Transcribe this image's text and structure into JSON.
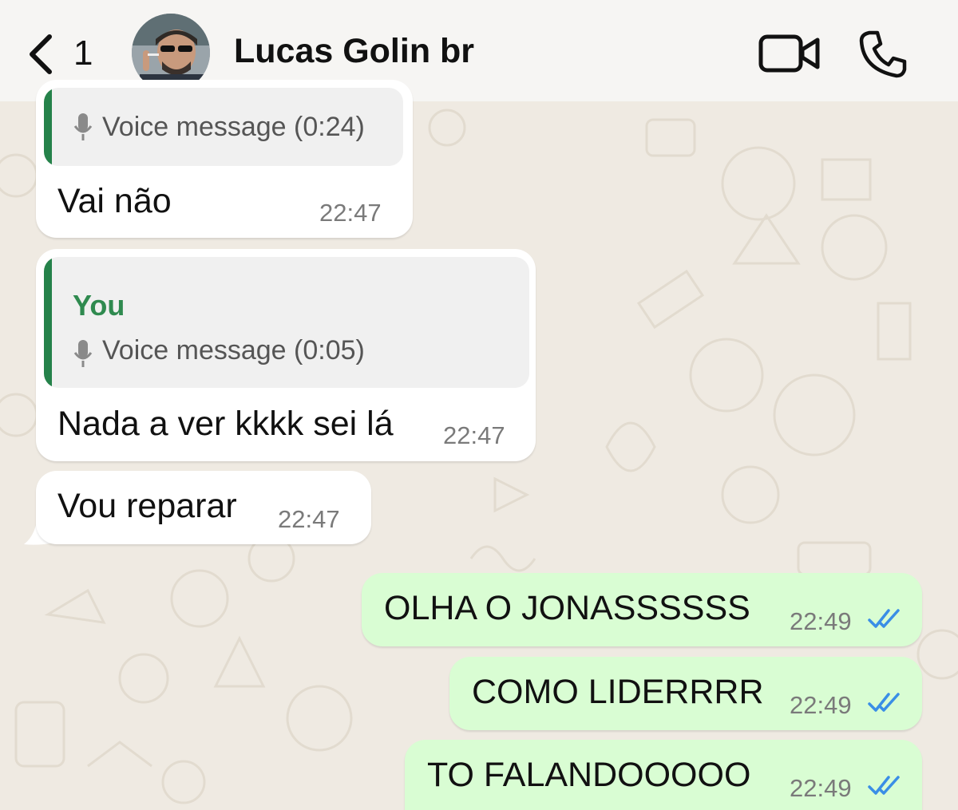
{
  "header": {
    "unread_count": "1",
    "contact_name": "Lucas Golin br"
  },
  "messages": [
    {
      "direction": "in",
      "quote": {
        "text": "Voice message (0:24)"
      },
      "text": "Vai não",
      "time": "22:47"
    },
    {
      "direction": "in",
      "quote": {
        "author": "You",
        "text": "Voice message (0:05)"
      },
      "text": "Nada a ver kkkk sei lá",
      "time": "22:47"
    },
    {
      "direction": "in",
      "text": "Vou reparar",
      "time": "22:47"
    },
    {
      "direction": "out",
      "text": "OLHA O JONASSSSSS",
      "time": "22:49",
      "status": "read"
    },
    {
      "direction": "out",
      "text": "COMO LIDERRRR",
      "time": "22:49",
      "status": "read"
    },
    {
      "direction": "out",
      "text": "TO FALANDOOOOO",
      "time": "22:49",
      "status": "read"
    }
  ],
  "colors": {
    "incoming_bubble": "#ffffff",
    "outgoing_bubble": "#d9fdd3",
    "quote_accent": "#25824a",
    "read_ticks": "#3a8ee6",
    "chat_background": "#efeae2"
  }
}
